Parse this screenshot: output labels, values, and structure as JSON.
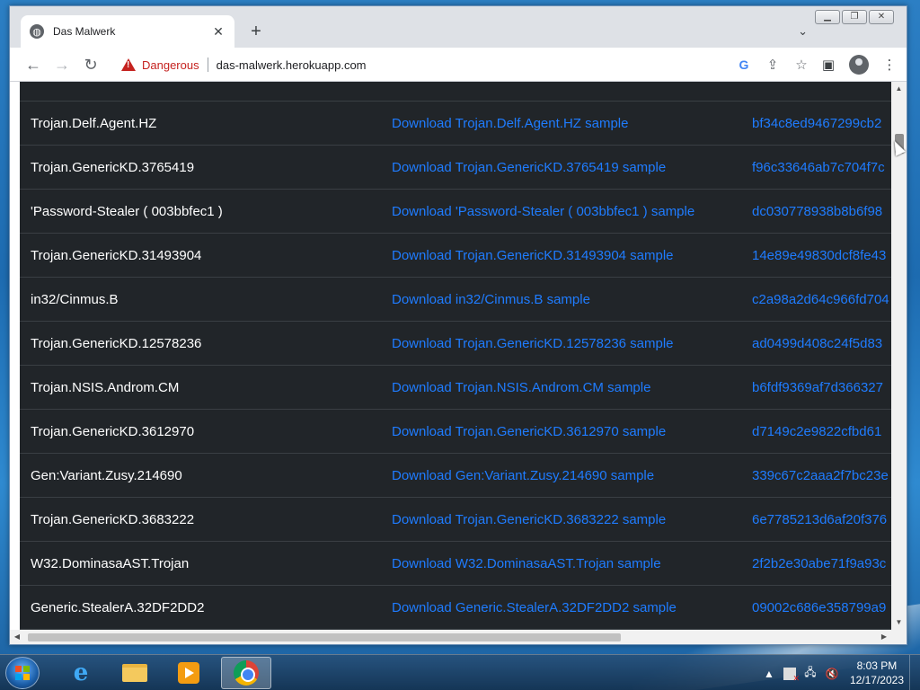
{
  "browser": {
    "tab_title": "Das Malwerk",
    "new_tab_label": "+",
    "security_label": "Dangerous",
    "url": "das-malwerk.herokuapp.com"
  },
  "table": {
    "rows": [
      {
        "name": "Trojan.Delf.Agent.HZ",
        "download": "Download Trojan.Delf.Agent.HZ sample",
        "hash": "bf34c8ed9467299cb2"
      },
      {
        "name": "Trojan.GenericKD.3765419",
        "download": "Download Trojan.GenericKD.3765419 sample",
        "hash": "f96c33646ab7c704f7c"
      },
      {
        "name": "'Password-Stealer ( 003bbfec1 )",
        "download": "Download 'Password-Stealer ( 003bbfec1 ) sample",
        "hash": "dc030778938b8b6f98"
      },
      {
        "name": "Trojan.GenericKD.31493904",
        "download": "Download Trojan.GenericKD.31493904 sample",
        "hash": "14e89e49830dcf8fe43"
      },
      {
        "name": "in32/Cinmus.B",
        "download": "Download in32/Cinmus.B sample",
        "hash": "c2a98a2d64c966fd704"
      },
      {
        "name": "Trojan.GenericKD.12578236",
        "download": "Download Trojan.GenericKD.12578236 sample",
        "hash": "ad0499d408c24f5d83"
      },
      {
        "name": "Trojan.NSIS.Androm.CM",
        "download": "Download Trojan.NSIS.Androm.CM sample",
        "hash": "b6fdf9369af7d366327"
      },
      {
        "name": "Trojan.GenericKD.3612970",
        "download": "Download Trojan.GenericKD.3612970 sample",
        "hash": "d7149c2e9822cfbd61"
      },
      {
        "name": "Gen:Variant.Zusy.214690",
        "download": "Download Gen:Variant.Zusy.214690 sample",
        "hash": "339c67c2aaa2f7bc23e"
      },
      {
        "name": "Trojan.GenericKD.3683222",
        "download": "Download Trojan.GenericKD.3683222 sample",
        "hash": "6e7785213d6af20f376"
      },
      {
        "name": "W32.DominasaAST.Trojan",
        "download": "Download W32.DominasaAST.Trojan sample",
        "hash": "2f2b2e30abe71f9a93c"
      },
      {
        "name": "Generic.StealerA.32DF2DD2",
        "download": "Download Generic.StealerA.32DF2DD2 sample",
        "hash": "09002c686e358799a9"
      }
    ]
  },
  "taskbar": {
    "time": "8:03 PM",
    "date": "12/17/2023"
  },
  "colors": {
    "page_bg": "#212529",
    "link": "#1f7cff",
    "danger": "#c5221f"
  },
  "icons": {
    "favicon": "globe-icon",
    "back": "back-arrow-icon",
    "forward": "forward-arrow-icon",
    "reload": "reload-icon",
    "warning": "warning-triangle-icon",
    "google": "google-icon",
    "share": "share-icon",
    "bookmark": "star-icon",
    "side_panel": "side-panel-icon",
    "profile": "profile-avatar-icon",
    "menu": "kebab-menu-icon"
  }
}
